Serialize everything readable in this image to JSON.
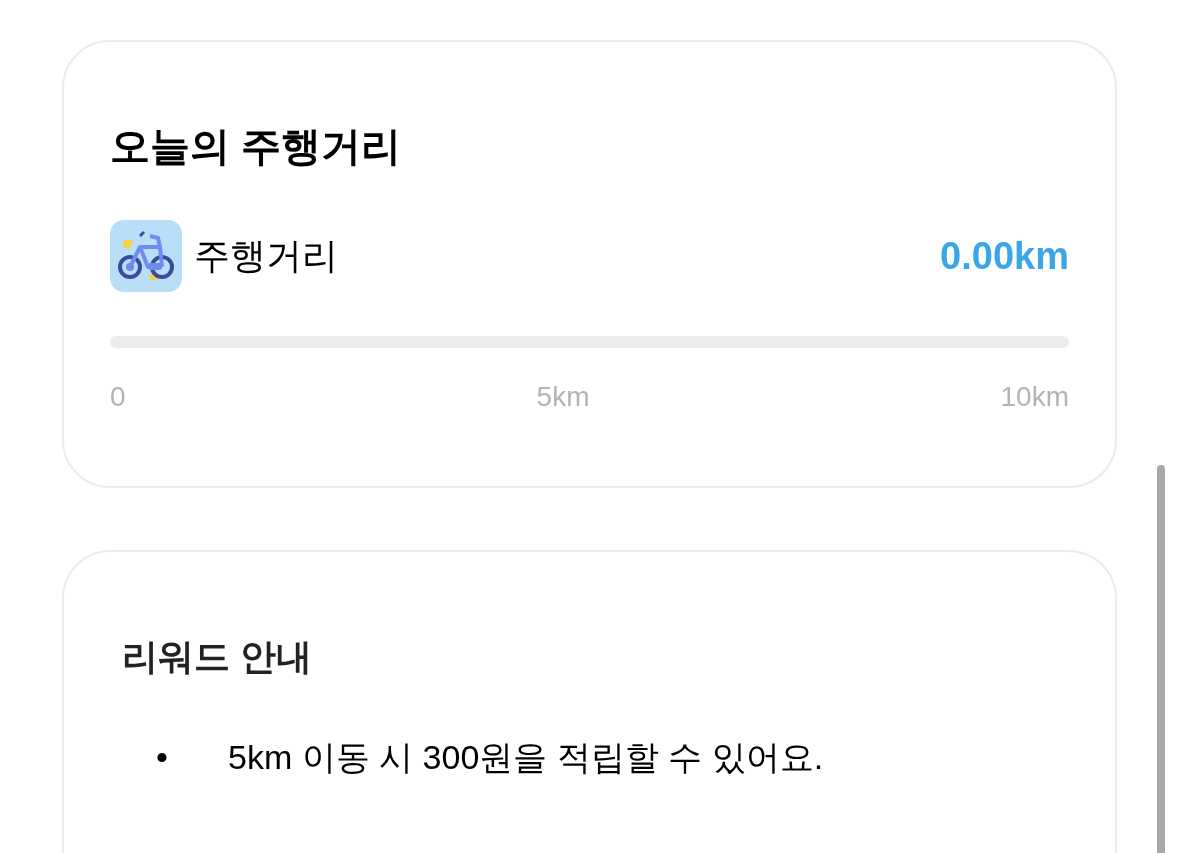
{
  "distance_card": {
    "title": "오늘의 주행거리",
    "label": "주행거리",
    "value": "0.00km",
    "progress": {
      "level": 0
    },
    "ticks": [
      "0",
      "5km",
      "10km"
    ]
  },
  "reward_card": {
    "title": "리워드 안내",
    "items": [
      {
        "bullet": "•",
        "text": "5km 이동 시 300원을 적립할 수 있어요."
      }
    ]
  }
}
